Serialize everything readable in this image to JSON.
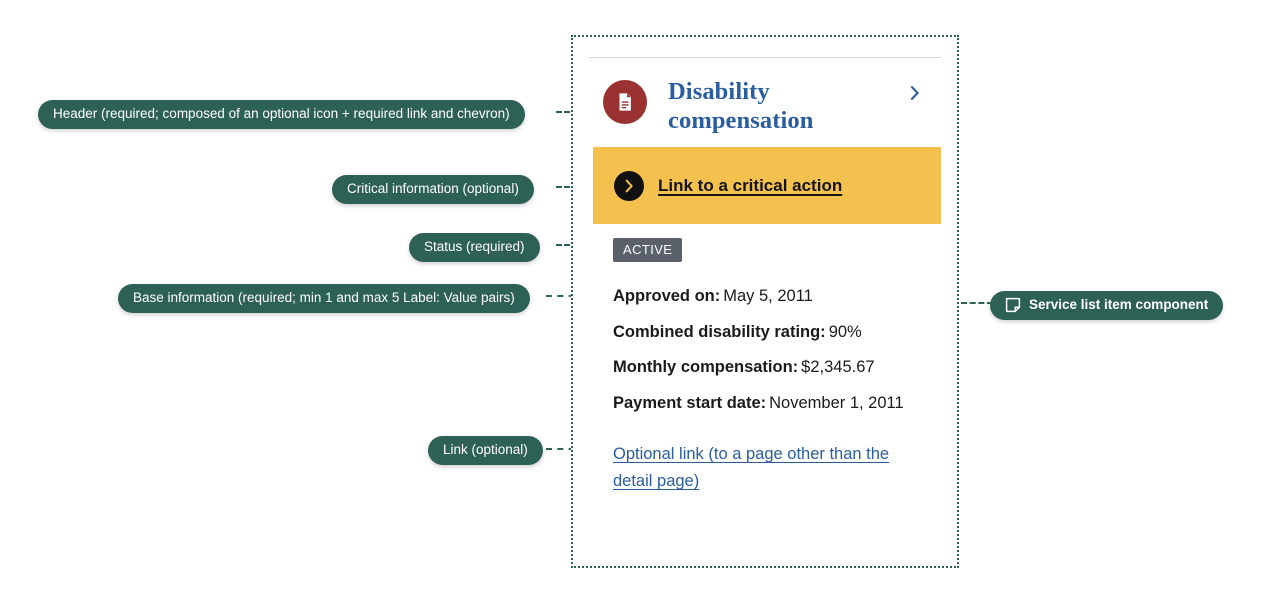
{
  "annotations": [
    {
      "id": "header",
      "label": "Header (required; composed of an optional icon + required link and chevron)"
    },
    {
      "id": "critical",
      "label": "Critical information (optional)"
    },
    {
      "id": "status",
      "label": "Status (required)"
    },
    {
      "id": "base",
      "label": "Base information (required; min 1 and max 5 Label: Value pairs)"
    },
    {
      "id": "link",
      "label": "Link (optional)"
    },
    {
      "id": "component",
      "label": "Service list item component",
      "icon": "component-sticker-icon"
    }
  ],
  "card": {
    "header": {
      "icon": "document-icon",
      "title": "Disability compensation",
      "chevron": "chevron-right-icon"
    },
    "critical": {
      "icon": "chevron-right-circle-icon",
      "link_label": "Link to a critical action"
    },
    "status": {
      "label": "ACTIVE"
    },
    "base_information": [
      {
        "label": "Approved on:",
        "value": "May 5, 2011"
      },
      {
        "label": "Combined disability rating:",
        "value": "90%"
      },
      {
        "label": "Monthly compensation:",
        "value": "$2,345.67"
      },
      {
        "label": "Payment start date:",
        "value": "November 1, 2011"
      }
    ],
    "optional_link": {
      "label": "Optional link (to a page other than the detail page)"
    }
  },
  "colors": {
    "annotation_green": "#2e6156",
    "critical_gold": "#f5c14e",
    "status_grey": "#5b616b",
    "link_blue": "#2a5d9f",
    "icon_maroon": "#9b3232"
  }
}
